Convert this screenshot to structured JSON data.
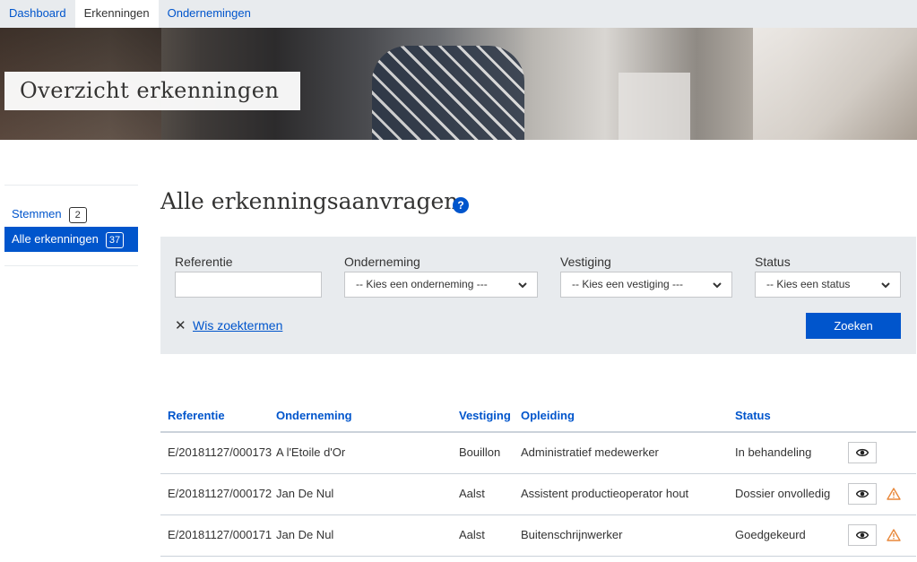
{
  "nav": {
    "tabs": [
      {
        "label": "Dashboard"
      },
      {
        "label": "Erkenningen"
      },
      {
        "label": "Ondernemingen"
      }
    ]
  },
  "hero": {
    "title": "Overzicht erkenningen"
  },
  "sidebar": {
    "items": [
      {
        "label": "Stemmen",
        "count": "2"
      },
      {
        "label": "Alle erkenningen",
        "count": "37"
      }
    ]
  },
  "main": {
    "title": "Alle erkenningsaanvragen",
    "help_icon": "?"
  },
  "filters": {
    "referentie_label": "Referentie",
    "referentie_value": "",
    "onderneming_label": "Onderneming",
    "onderneming_value": "-- Kies een onderneming ---",
    "vestiging_label": "Vestiging",
    "vestiging_value": "-- Kies een vestiging ---",
    "status_label": "Status",
    "status_value": "-- Kies een status",
    "clear_icon": "✕",
    "clear_label": "Wis zoektermen",
    "search_label": "Zoeken"
  },
  "table": {
    "headers": [
      "Referentie",
      "Onderneming",
      "Vestiging",
      "Opleiding",
      "Status"
    ],
    "rows": [
      {
        "ref": "E/20181127/000173",
        "onderneming": "A l'Etoile d'Or",
        "vestiging": "Bouillon",
        "opleiding": "Administratief medewerker",
        "status": "In behandeling",
        "warning": false
      },
      {
        "ref": "E/20181127/000172",
        "onderneming": "Jan De Nul",
        "vestiging": "Aalst",
        "opleiding": "Assistent productieoperator hout",
        "status": "Dossier onvolledig",
        "warning": true
      },
      {
        "ref": "E/20181127/000171",
        "onderneming": "Jan De Nul",
        "vestiging": "Aalst",
        "opleiding": "Buitenschrijnwerker",
        "status": "Goedgekeurd",
        "warning": true
      }
    ]
  },
  "colors": {
    "accent": "#0055cc",
    "panel": "#e8ebee",
    "warning": "#e8873a"
  },
  "icons": {
    "view": "eye-icon",
    "warning": "warning-icon",
    "select": "chevron-down-icon"
  }
}
